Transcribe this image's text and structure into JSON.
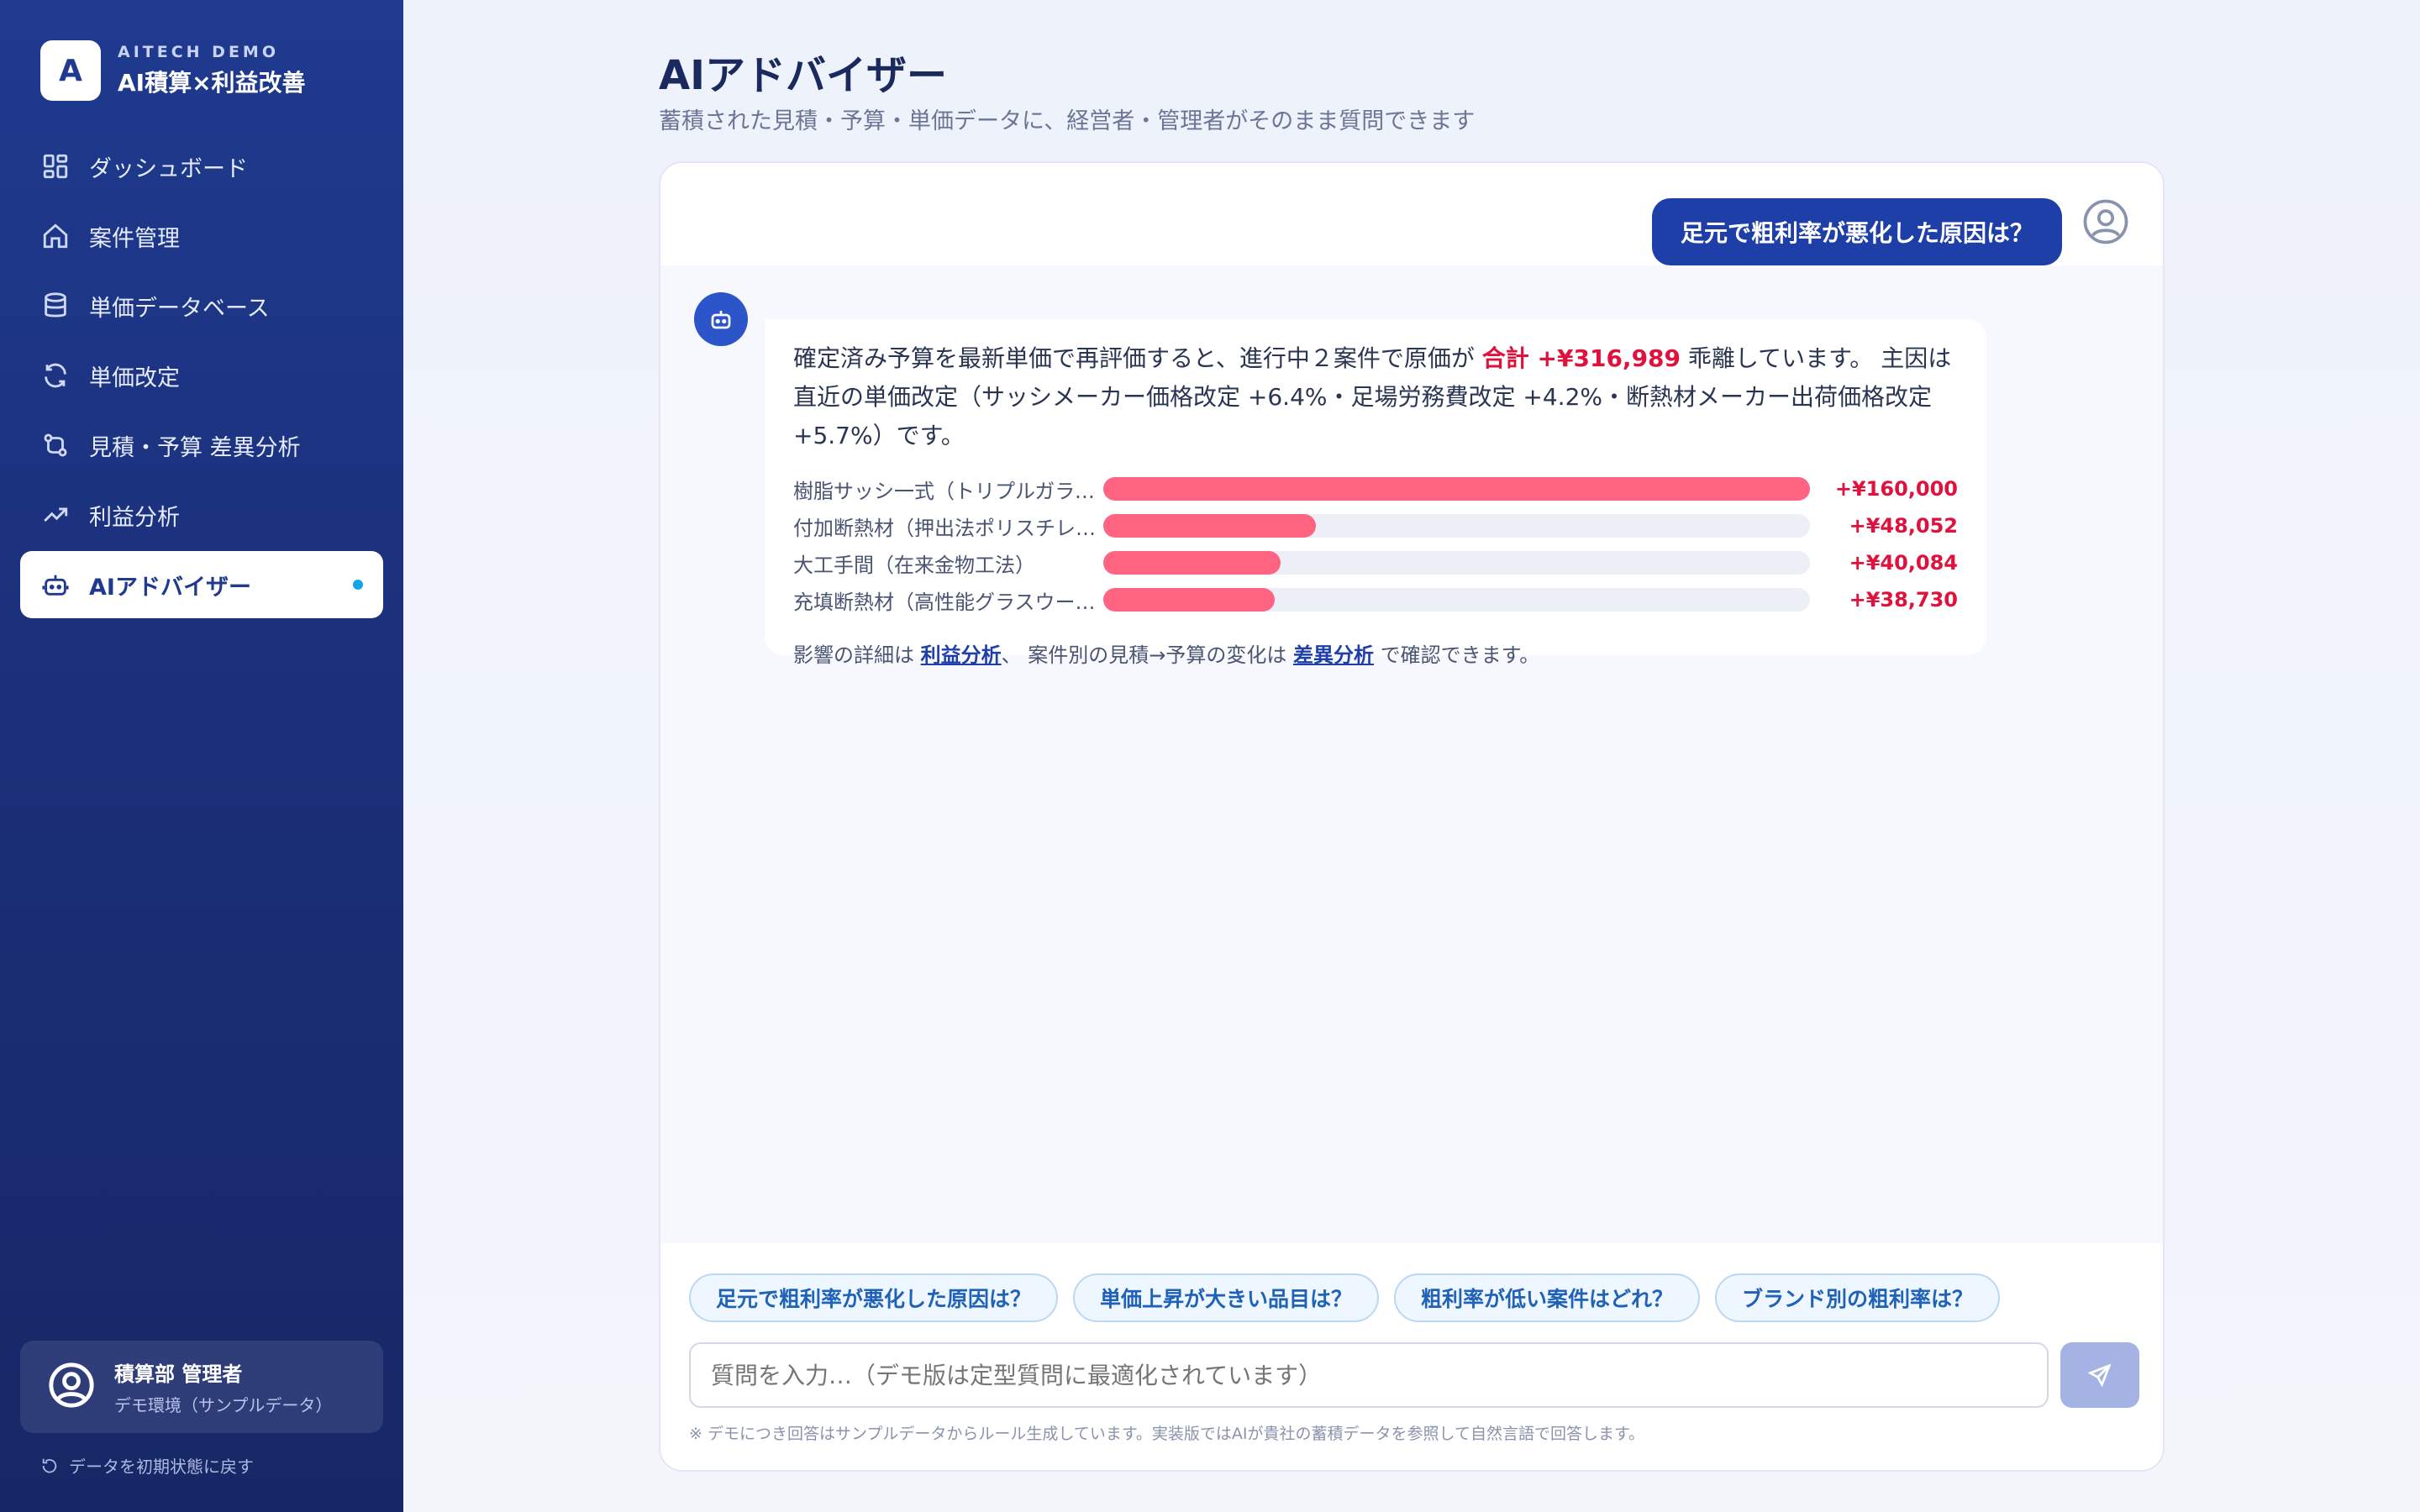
{
  "brand": {
    "logo_letter": "A",
    "sub": "AITECH DEMO",
    "title": "AI積算×利益改善"
  },
  "nav": {
    "items": [
      {
        "label": "ダッシュボード",
        "icon": "dashboard-icon"
      },
      {
        "label": "案件管理",
        "icon": "home-icon"
      },
      {
        "label": "単価データベース",
        "icon": "database-icon"
      },
      {
        "label": "単価改定",
        "icon": "refresh-icon"
      },
      {
        "label": "見積・予算 差異分析",
        "icon": "compare-icon"
      },
      {
        "label": "利益分析",
        "icon": "trend-icon"
      },
      {
        "label": "AIアドバイザー",
        "icon": "robot-icon",
        "active": true
      }
    ]
  },
  "user": {
    "name": "積算部 管理者",
    "sub": "デモ環境（サンプルデータ）"
  },
  "reset_label": "データを初期状態に戻す",
  "page": {
    "title": "AIアドバイザー",
    "subtitle": "蓄積された見積・予算・単価データに、経営者・管理者がそのまま質問できます"
  },
  "chat": {
    "user_message": "足元で粗利率が悪化した原因は？",
    "bot": {
      "text_before": "確定済み予算を最新単価で再評価すると、進行中２案件で原価が ",
      "highlight": "合計 +¥316,989",
      "text_after": " 乖離しています。 主因は直近の単価改定（サッシメーカー価格改定 +6.4%・足場労務費改定 +4.2%・断熱材メーカー出荷価格改定 +5.7%）です。",
      "bars": [
        {
          "label": "樹脂サッシ一式（トリプルガラス）",
          "value": 160000,
          "value_label": "+¥160,000"
        },
        {
          "label": "付加断熱材（押出法ポリスチレンフォーム）",
          "value": 48052,
          "value_label": "+¥48,052"
        },
        {
          "label": "大工手間（在来金物工法）",
          "value": 40084,
          "value_label": "+¥40,084"
        },
        {
          "label": "充填断熱材（高性能グラスウール）",
          "value": 38730,
          "value_label": "+¥38,730"
        }
      ],
      "bar_max": 160000,
      "foot_1": "影響の詳細は ",
      "link_1": "利益分析",
      "foot_2": "、 案件別の見積→予算の変化は ",
      "link_2": "差異分析",
      "foot_3": " で確認できます。"
    },
    "suggestions": [
      "足元で粗利率が悪化した原因は？",
      "単価上昇が大きい品目は？",
      "粗利率が低い案件はどれ？",
      "ブランド別の粗利率は？"
    ],
    "input_placeholder": "質問を入力…（デモ版は定型質問に最適化されています）",
    "disclaimer": "※ デモにつき回答はサンプルデータからルール生成しています。実装版ではAIが貴社の蓄積データを参照して自然言語で回答します。"
  },
  "colors": {
    "accent": "#1f3fa8",
    "negative": "#e0123d",
    "bar": "#ff6480"
  }
}
